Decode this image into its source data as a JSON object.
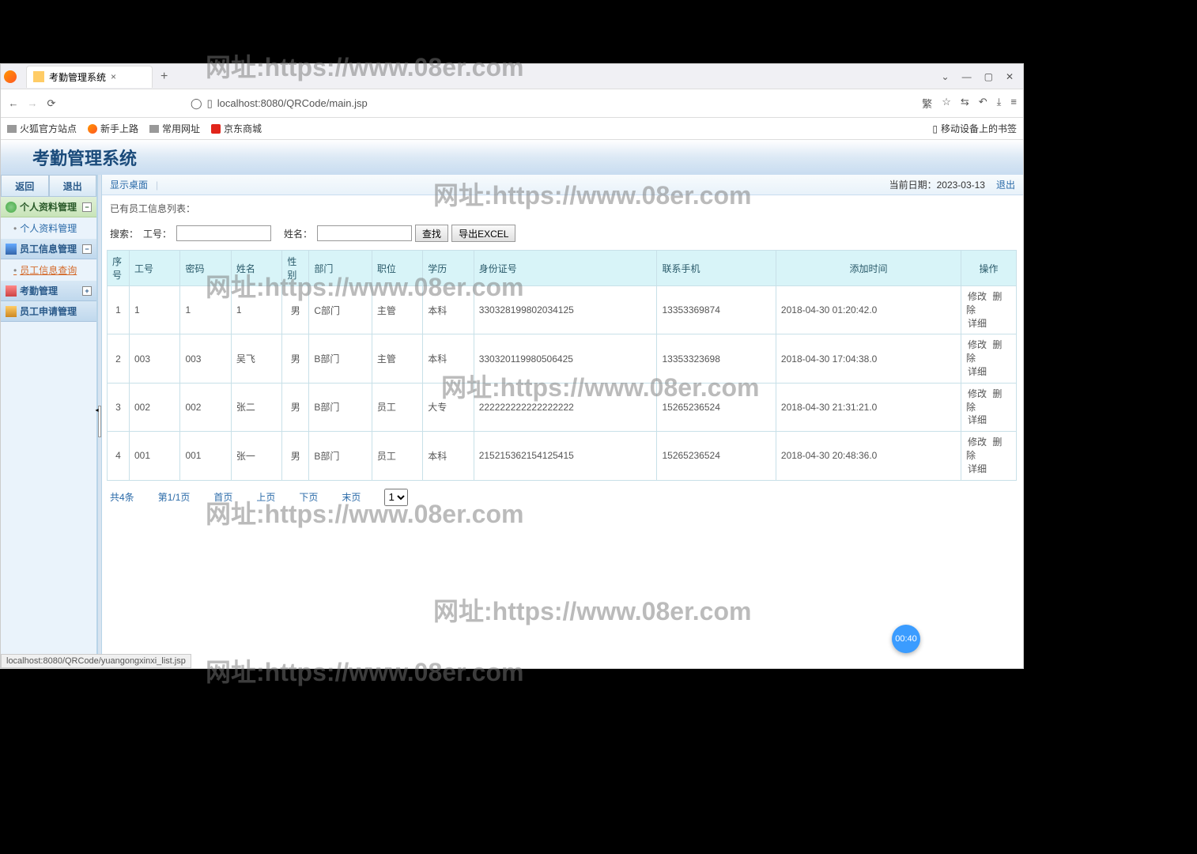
{
  "browser": {
    "tab_title": "考勤管理系统",
    "url": "localhost:8080/QRCode/main.jsp",
    "bookmarks": [
      "火狐官方站点",
      "新手上路",
      "常用网址",
      "京东商城"
    ],
    "bookmark_right": "移动设备上的书签",
    "win": {
      "chevron": "⌄",
      "min": "—",
      "max": "▢",
      "close": "✕"
    }
  },
  "app": {
    "title": "考勤管理系统",
    "sidebar": {
      "back": "返回",
      "exit": "退出",
      "groups": [
        {
          "label": "个人资料管理",
          "items": [
            "个人资料管理"
          ]
        },
        {
          "label": "员工信息管理",
          "items": [
            "员工信息查询"
          ]
        },
        {
          "label": "考勤管理",
          "items": []
        },
        {
          "label": "员工申请管理",
          "items": []
        }
      ]
    },
    "crumb": {
      "home": "显示桌面",
      "date_label": "当前日期：",
      "date": "2023-03-13",
      "exit": "退出"
    },
    "list_title": "已有员工信息列表：",
    "search": {
      "label": "搜索：",
      "gh": "工号：",
      "xm": "姓名：",
      "find": "查找",
      "export": "导出EXCEL"
    },
    "columns": [
      "序号",
      "工号",
      "密码",
      "姓名",
      "性别",
      "部门",
      "职位",
      "学历",
      "身份证号",
      "联系手机",
      "添加时间",
      "操作"
    ],
    "rows": [
      {
        "seq": "1",
        "gh": "1",
        "pwd": "1",
        "name": "1",
        "sex": "男",
        "dept": "C部门",
        "pos": "主管",
        "edu": "本科",
        "idc": "330328199802034125",
        "tel": "13353369874",
        "time": "2018-04-30 01:20:42.0"
      },
      {
        "seq": "2",
        "gh": "003",
        "pwd": "003",
        "name": "吴飞",
        "sex": "男",
        "dept": "B部门",
        "pos": "主管",
        "edu": "本科",
        "idc": "330320119980506425",
        "tel": "13353323698",
        "time": "2018-04-30 17:04:38.0"
      },
      {
        "seq": "3",
        "gh": "002",
        "pwd": "002",
        "name": "张二",
        "sex": "男",
        "dept": "B部门",
        "pos": "员工",
        "edu": "大专",
        "idc": "222222222222222222",
        "tel": "15265236524",
        "time": "2018-04-30 21:31:21.0"
      },
      {
        "seq": "4",
        "gh": "001",
        "pwd": "001",
        "name": "张一",
        "sex": "男",
        "dept": "B部门",
        "pos": "员工",
        "edu": "本科",
        "idc": "215215362154125415",
        "tel": "15265236524",
        "time": "2018-04-30 20:48:36.0"
      }
    ],
    "ops": {
      "edit": "修改",
      "del": "删除",
      "detail": "详细"
    },
    "pager": {
      "total": "共4条",
      "page": "第1/1页",
      "first": "首页",
      "prev": "上页",
      "next": "下页",
      "last": "末页",
      "sel": "1"
    },
    "status": "localhost:8080/QRCode/yuangongxinxi_list.jsp"
  },
  "watermark": "网址:https://www.08er.com",
  "timer": "00:40"
}
